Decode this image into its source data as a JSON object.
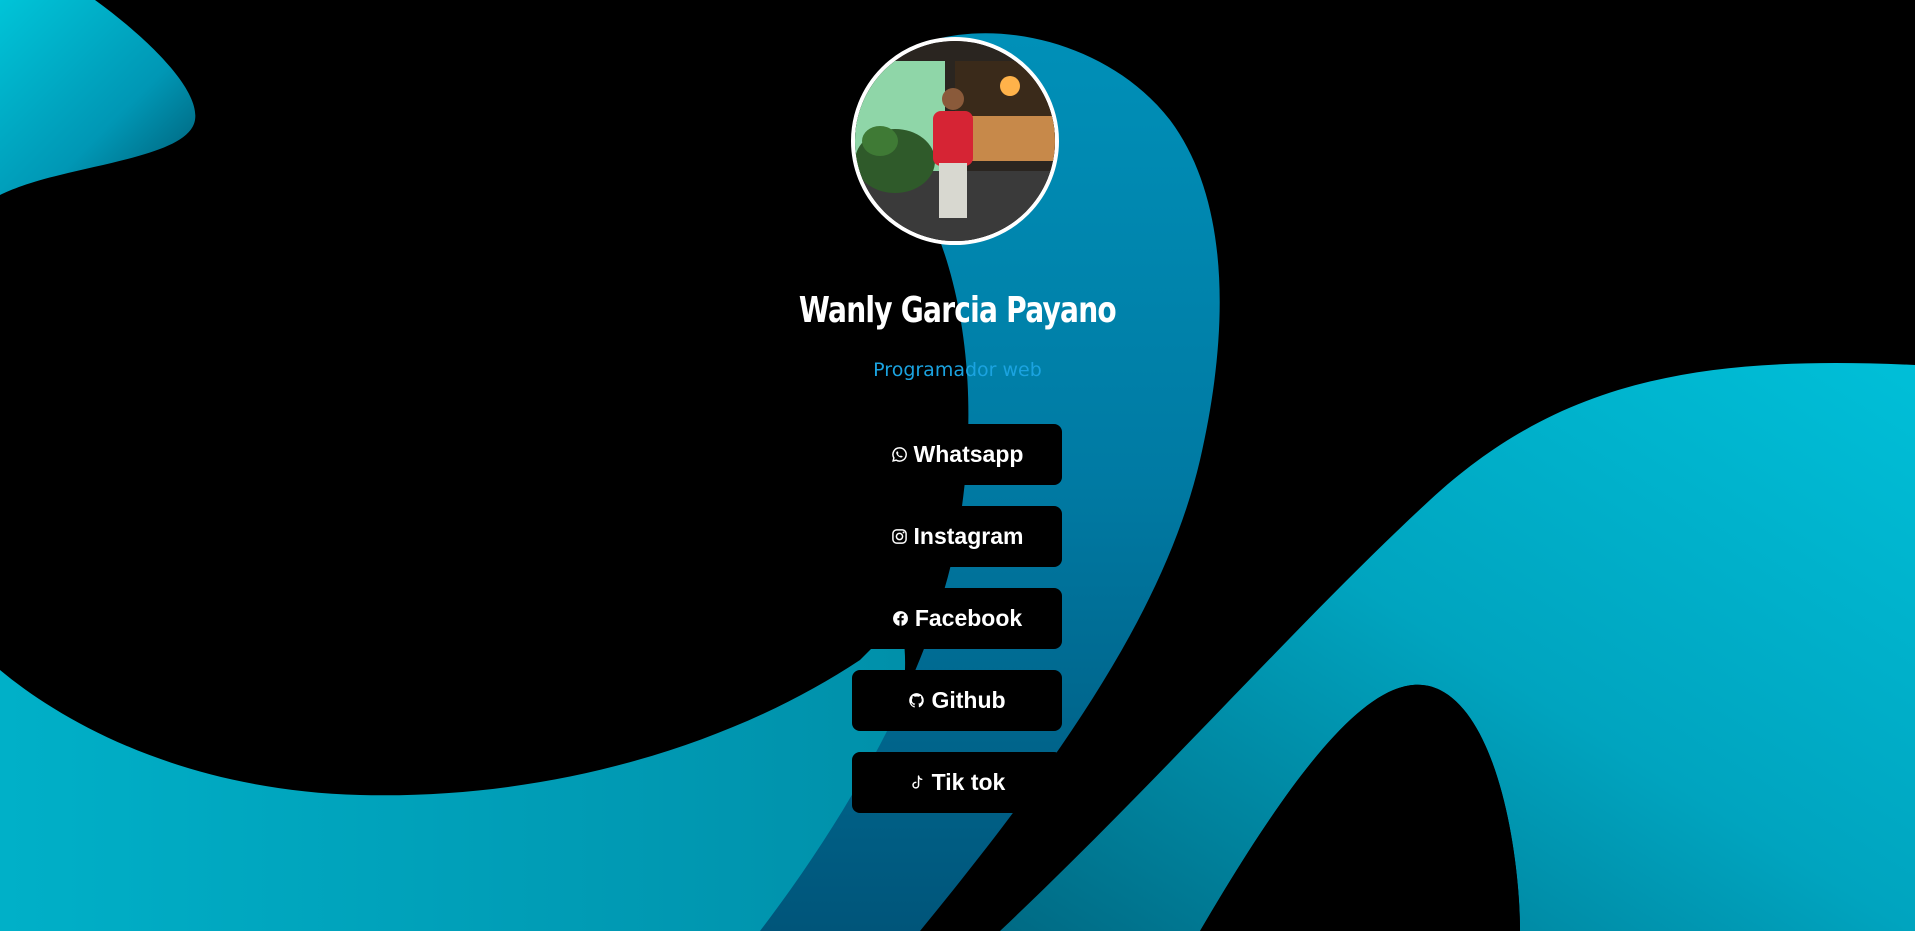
{
  "profile": {
    "name": "Wanly Garcia Payano",
    "role": "Programador web"
  },
  "links": [
    {
      "label": "Whatsapp",
      "icon": "whatsapp-icon"
    },
    {
      "label": "Instagram",
      "icon": "instagram-icon"
    },
    {
      "label": "Facebook",
      "icon": "facebook-icon"
    },
    {
      "label": "Github",
      "icon": "github-icon"
    },
    {
      "label": "Tik tok",
      "icon": "tiktok-icon"
    }
  ],
  "colors": {
    "background": "#000000",
    "accent": "#1ba3e0",
    "shape": "#00b8d0",
    "button": "#000000",
    "text": "#ffffff"
  }
}
